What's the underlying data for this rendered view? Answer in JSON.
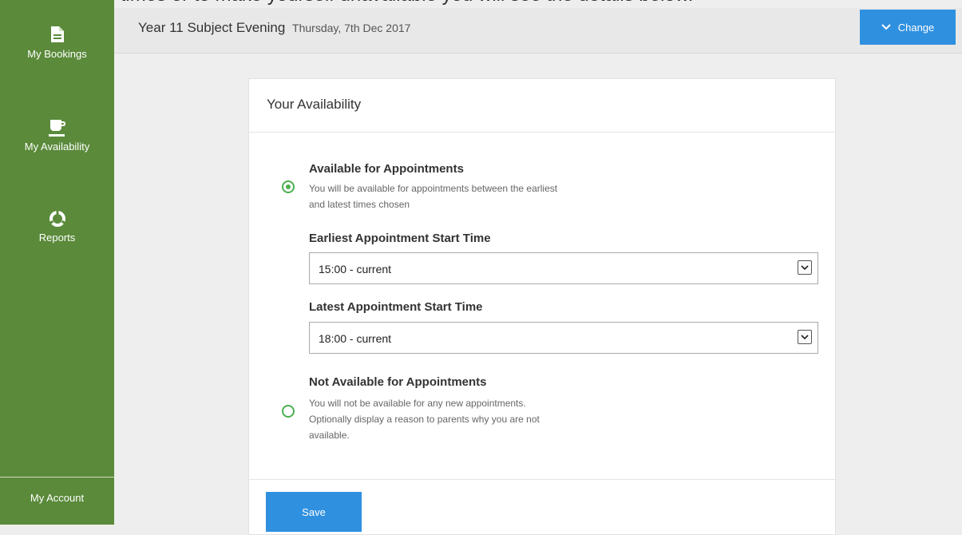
{
  "banner_text": "appointments times or to make yourself unavailable you will see the details below.",
  "sidebar": {
    "items": [
      {
        "label": "My Bookings",
        "icon": "document-icon"
      },
      {
        "label": "My Availability",
        "icon": "coffee-cup-icon"
      },
      {
        "label": "Reports",
        "icon": "donut-chart-icon"
      }
    ],
    "account_label": "My Account",
    "color": "#5a8a3a"
  },
  "header": {
    "event_title": "Year 11 Subject Evening",
    "event_date": "Thursday, 7th Dec 2017",
    "change_label": "Change"
  },
  "card": {
    "title": "Your Availability",
    "available": {
      "title": "Available for Appointments",
      "desc_line1": "You will be available for appointments between the earliest",
      "desc_line2": "and latest times chosen",
      "selected": true
    },
    "earliest": {
      "label": "Earliest Appointment Start Time",
      "value": "15:00 - current"
    },
    "latest": {
      "label": "Latest Appointment Start Time",
      "value": "18:00 - current"
    },
    "unavailable": {
      "title": "Not Available for Appointments",
      "desc_line1": "You will not be available for any new appointments.",
      "desc_line2": "Optionally display a reason to parents why you are not",
      "desc_line3": "available.",
      "selected": false
    },
    "save_label": "Save"
  },
  "colors": {
    "accent": "#2f90e0",
    "radio": "#4caf50"
  }
}
